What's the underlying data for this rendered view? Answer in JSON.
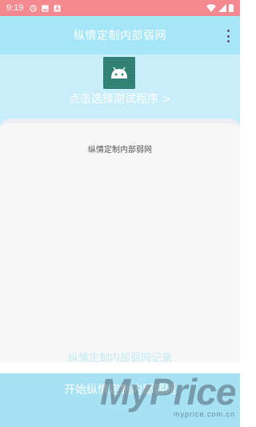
{
  "status_bar": {
    "time": "9:19",
    "icons": [
      "clock-icon",
      "image-icon",
      "a-icon",
      "wifi-icon",
      "signal-icon",
      "battery-icon"
    ],
    "color": "#f48a8f"
  },
  "app_bar": {
    "title": "纵情定制内部弱网",
    "menu_icon": "overflow-menu-icon",
    "color": "#a6e6f9"
  },
  "hero": {
    "app_icon": "android-icon",
    "select_label": "点击选择测试程序 >"
  },
  "card": {
    "title": "纵情定制内部弱网"
  },
  "footer": {
    "record_label": "纵情定制内部弱网记录",
    "start_label": "开始纵情定制内部弱网"
  },
  "watermark": {
    "brand": "MyPrice",
    "site": "myprice.com.cn"
  }
}
